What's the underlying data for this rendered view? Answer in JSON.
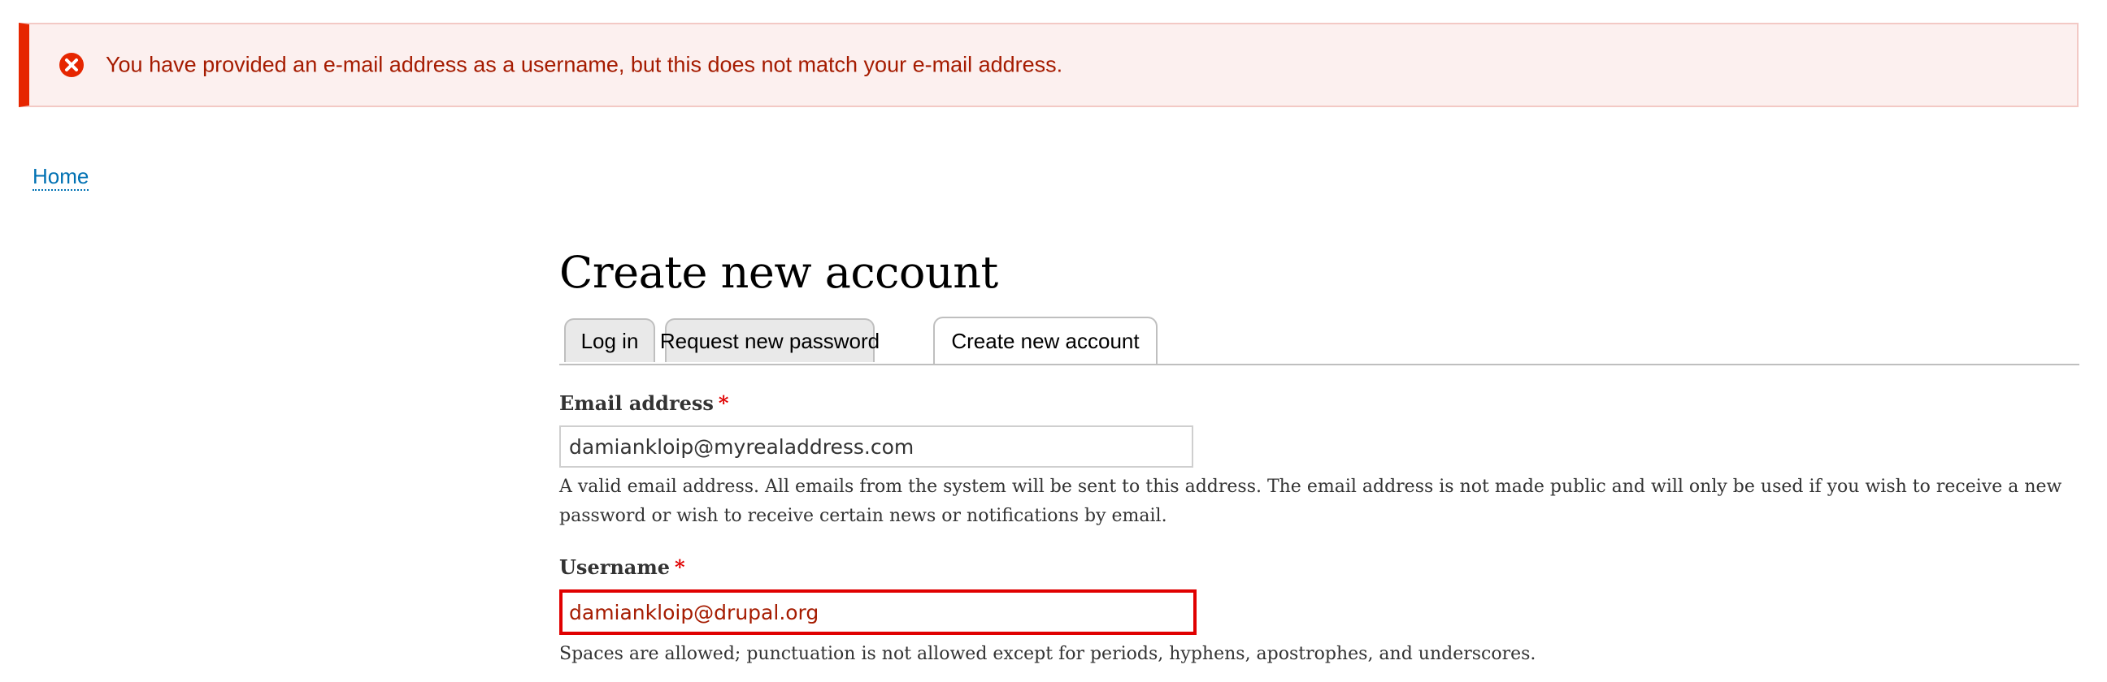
{
  "error_message": {
    "icon": "error-circle-x-icon",
    "text": "You have provided an e-mail address as a username, but this does not match your e-mail address.",
    "colors": {
      "accent": "#e62600",
      "background": "#fcf0ef",
      "text": "#a51b00"
    }
  },
  "breadcrumb": {
    "home_label": "Home"
  },
  "page": {
    "title": "Create new account"
  },
  "tabs": [
    {
      "label": "Log in",
      "active": false
    },
    {
      "label": "Request new password",
      "active": false
    },
    {
      "label": "Create new account",
      "active": true
    }
  ],
  "form": {
    "email": {
      "label": "Email address",
      "required_marker": "*",
      "value": "damiankloip@myrealaddress.com",
      "description": "A valid email address. All emails from the system will be sent to this address. The email address is not made public and will only be used if you wish to receive a new password or wish to receive certain news or notifications by email."
    },
    "username": {
      "label": "Username",
      "required_marker": "*",
      "value": "damiankloip@drupal.org",
      "has_error": true,
      "description": "Spaces are allowed; punctuation is not allowed except for periods, hyphens, apostrophes, and underscores."
    }
  }
}
